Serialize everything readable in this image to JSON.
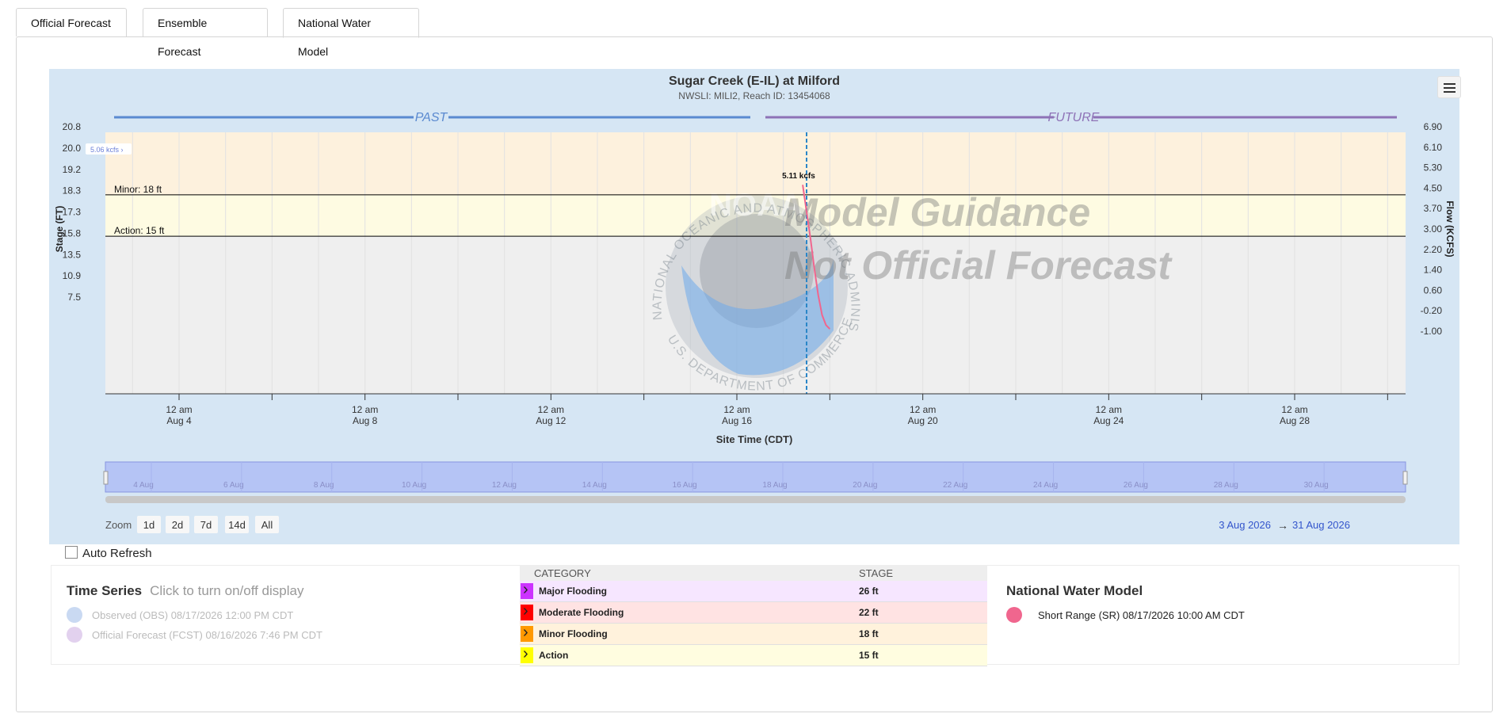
{
  "tabs": [
    {
      "label": "Official Forecast"
    },
    {
      "label": "Ensemble Forecast"
    },
    {
      "label": "National Water Model"
    }
  ],
  "chart": {
    "title": "Sugar Creek (E-IL) at Milford",
    "subtitle": "NWSLI: MILI2, Reach ID: 13454068",
    "past_label": "PAST",
    "future_label": "FUTURE",
    "watermark_line1": "Model Guidance",
    "watermark_line2": "Not Official Forecast",
    "seal_text_top": "NATIONAL OCEANIC AND ATMOSPHERIC ADMINISTRATION",
    "seal_text_bottom": "U.S. DEPARTMENT OF COMMERCE",
    "seal_abbrev": "NOAA",
    "y_left_label": "Stage (FT)",
    "y_right_label": "Flow (KCFS)",
    "x_label": "Site Time (CDT)",
    "minor_label": "Minor: 18 ft",
    "action_label": "Action: 15 ft",
    "flow_callout": "5.11 kcfs",
    "nav_flag": "5.06 kcfs"
  },
  "chart_data": {
    "type": "line",
    "title": "Sugar Creek (E-IL) at Milford",
    "subtitle": "NWSLI: MILI2, Reach ID: 13454068",
    "xlabel": "Site Time (CDT)",
    "ylabel": "Stage (FT)",
    "y2label": "Flow (KCFS)",
    "xlim": [
      "2026-08-03",
      "2026-08-31"
    ],
    "ylim": [
      5.6,
      20.8
    ],
    "y_ticks_left": [
      "20.8",
      "20.0",
      "19.2",
      "18.3",
      "17.3",
      "15.8",
      "13.5",
      "10.9",
      "7.5"
    ],
    "y_ticks_right": [
      "6.90",
      "6.10",
      "5.30",
      "4.50",
      "3.70",
      "3.00",
      "2.20",
      "1.40",
      "0.60",
      "-0.20",
      "-1.00"
    ],
    "x_ticks": [
      {
        "l1": "12 am",
        "l2": "Aug 4"
      },
      {
        "l1": "12 am",
        "l2": "Aug 8"
      },
      {
        "l1": "12 am",
        "l2": "Aug 12"
      },
      {
        "l1": "12 am",
        "l2": "Aug 16"
      },
      {
        "l1": "12 am",
        "l2": "Aug 20"
      },
      {
        "l1": "12 am",
        "l2": "Aug 24"
      },
      {
        "l1": "12 am",
        "l2": "Aug 28"
      }
    ],
    "thresholds": [
      {
        "name": "Minor",
        "stage_ft": 18
      },
      {
        "name": "Action",
        "stage_ft": 15
      }
    ],
    "current_time": "2026-08-17 12:00",
    "series": [
      {
        "name": "Short Range (SR) 08/17/2026 10:00 AM CDT",
        "color": "#f0668e",
        "points": [
          {
            "t": "2026-08-17 10:00",
            "kcfs": 5.11
          },
          {
            "t": "2026-08-17 12:00",
            "kcfs": 4.3
          },
          {
            "t": "2026-08-17 14:00",
            "kcfs": 3.5
          },
          {
            "t": "2026-08-17 16:00",
            "kcfs": 2.6
          },
          {
            "t": "2026-08-17 18:00",
            "kcfs": 1.8
          },
          {
            "t": "2026-08-17 20:00",
            "kcfs": 1.2
          },
          {
            "t": "2026-08-17 22:00",
            "kcfs": 0.9
          },
          {
            "t": "2026-08-18 00:00",
            "kcfs": 0.78
          }
        ]
      }
    ],
    "grid": true
  },
  "navigator": {
    "labels": [
      "4 Aug",
      "6 Aug",
      "8 Aug",
      "10 Aug",
      "12 Aug",
      "14 Aug",
      "16 Aug",
      "18 Aug",
      "20 Aug",
      "22 Aug",
      "24 Aug",
      "26 Aug",
      "28 Aug",
      "30 Aug"
    ]
  },
  "zoom": {
    "label": "Zoom",
    "buttons": [
      "1d",
      "2d",
      "7d",
      "14d",
      "All"
    ],
    "range_from": "3 Aug 2026",
    "range_arrow": "→",
    "range_to": "31 Aug 2026"
  },
  "auto_refresh": {
    "label": "Auto Refresh"
  },
  "time_series": {
    "title": "Time Series",
    "hint": "Click to turn on/off display",
    "items": [
      {
        "label": "Observed (OBS) 08/17/2026 12:00 PM CDT",
        "color": "#c9d9f2"
      },
      {
        "label": "Official Forecast (FCST) 08/16/2026 7:46 PM CDT",
        "color": "#e2d1ee"
      }
    ]
  },
  "categories": {
    "col_category": "CATEGORY",
    "col_stage": "STAGE",
    "rows": [
      {
        "name": "Major Flooding",
        "stage": "26 ft",
        "color": "#cc33ff",
        "bg": "#f6e6ff"
      },
      {
        "name": "Moderate Flooding",
        "stage": "22 ft",
        "color": "#ff0000",
        "bg": "#ffe3e3"
      },
      {
        "name": "Minor Flooding",
        "stage": "18 ft",
        "color": "#ff9900",
        "bg": "#fff2dc"
      },
      {
        "name": "Action",
        "stage": "15 ft",
        "color": "#ffff00",
        "bg": "#fffde0"
      }
    ]
  },
  "nwm": {
    "title": "National Water Model",
    "items": [
      {
        "label": "Short Range (SR) 08/17/2026 10:00 AM CDT",
        "color": "#f0668e"
      }
    ]
  }
}
